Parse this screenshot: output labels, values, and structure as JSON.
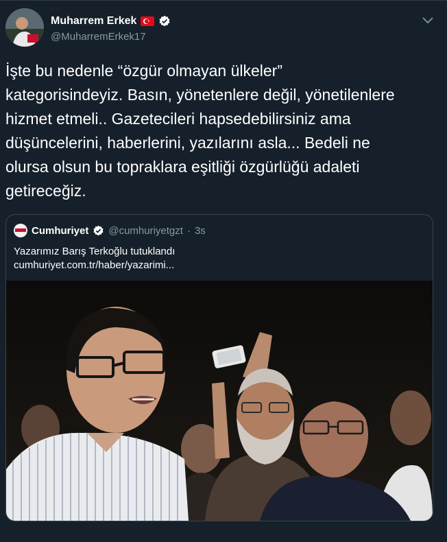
{
  "tweet": {
    "author": {
      "display_name": "Muharrem Erkek",
      "handle": "@MuharremErkek17",
      "flag_icon": "turkey-flag-icon",
      "verified_icon": "verified-badge-icon"
    },
    "menu_icon": "chevron-down-icon",
    "text": "İşte bu nedenle “özgür olmayan ülkeler”\nkategorisindeyiz. Basın, yönetenlere değil, yönetilenlere\nhizmet etmeli.. Gazetecileri hapsedebilirsiniz ama\ndüşüncelerini, haberlerini, yazılarını asla... Bedeli ne\nolursa olsun bu topraklara eşitliği özgürlüğü adaleti\ngetireceğiz."
  },
  "quoted_tweet": {
    "display_name": "Cumhuriyet",
    "handle": "@cumhuriyetgzt",
    "separator": "·",
    "time": "3s",
    "text": "Yazarımız Barış Terkoğlu tutuklandı",
    "link": "cumhuriyet.com.tr/haber/yazarimi...",
    "photo": "news-photo"
  },
  "colors": {
    "background": "#15202b",
    "border": "#38444d",
    "secondary_text": "#8899a6",
    "verified": "#ffffff"
  }
}
